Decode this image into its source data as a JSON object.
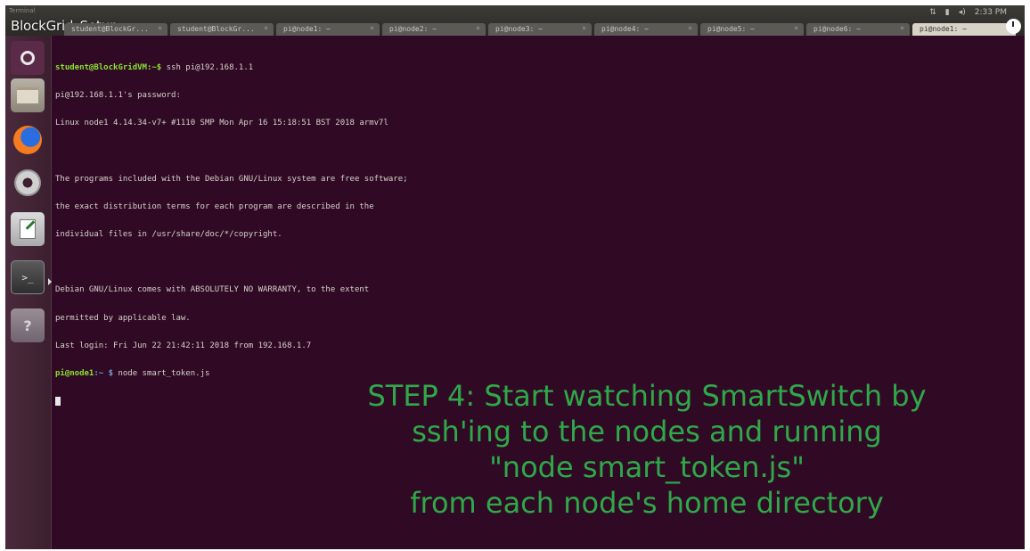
{
  "video": {
    "title": "BlockGrid_Setup",
    "small_label": "Terminal"
  },
  "tabs": [
    {
      "label": "student@BlockGr..."
    },
    {
      "label": "student@BlockGr..."
    },
    {
      "label": "pi@node1: ~"
    },
    {
      "label": "pi@node2: ~"
    },
    {
      "label": "pi@node3: ~"
    },
    {
      "label": "pi@node4: ~"
    },
    {
      "label": "pi@node5: ~"
    },
    {
      "label": "pi@node6: ~"
    },
    {
      "label": "pi@node1: ~"
    }
  ],
  "tray": {
    "keyboard": "⇅",
    "battery": "▮",
    "volume": "◂)",
    "time": "2:33 PM"
  },
  "launcher": {
    "terminal_glyph": ">_",
    "help_glyph": "?"
  },
  "terminal": {
    "prompt1_user": "student@BlockGridVM:~$",
    "prompt1_cmd": " ssh pi@192.168.1.1",
    "line_password": "pi@192.168.1.1's password:",
    "line_uname": "Linux node1 4.14.34-v7+ #1110 SMP Mon Apr 16 15:18:51 BST 2018 armv7l",
    "line_blank1": "",
    "line_programs1": "The programs included with the Debian GNU/Linux system are free software;",
    "line_programs2": "the exact distribution terms for each program are described in the",
    "line_programs3": "individual files in /usr/share/doc/*/copyright.",
    "line_blank2": "",
    "line_warranty1": "Debian GNU/Linux comes with ABSOLUTELY NO WARRANTY, to the extent",
    "line_warranty2": "permitted by applicable law.",
    "line_lastlogin": "Last login: Fri Jun 22 21:42:11 2018 from 192.168.1.7",
    "prompt2_user": "pi@node1",
    "prompt2_path": ":~ $",
    "prompt2_cmd": " node smart_token.js"
  },
  "caption": {
    "line1": "STEP 4: Start watching SmartSwitch by",
    "line2": "ssh'ing to the nodes and running",
    "line3": "\"node smart_token.js\"",
    "line4": "from each node's home directory"
  },
  "colors": {
    "terminal_bg": "#300a24",
    "caption_green": "#2fa84a",
    "prompt_green": "#8ae234",
    "prompt_blue": "#729fcf"
  }
}
